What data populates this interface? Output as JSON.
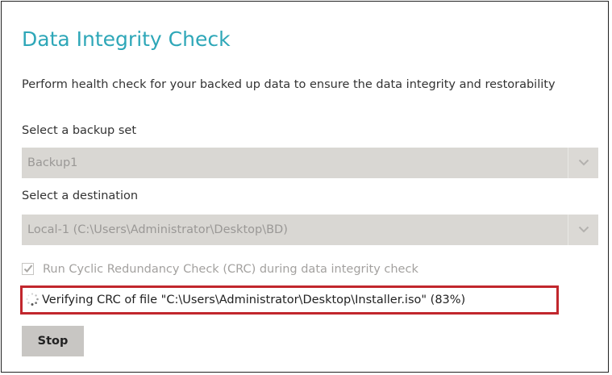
{
  "dialog": {
    "title": "Data Integrity Check",
    "description": "Perform health check for your backed up data to ensure the data integrity and restorability"
  },
  "backup_set": {
    "label": "Select a backup set",
    "selected_value": "Backup1",
    "arrow_icon": "chevron-down-icon"
  },
  "destination": {
    "label": "Select a destination",
    "selected_value": "Local-1 (C:\\Users\\Administrator\\Desktop\\BD)",
    "arrow_icon": "chevron-down-icon"
  },
  "crc_option": {
    "label": "Run Cyclic Redundancy Check (CRC) during data integrity check",
    "checked": true,
    "disabled": true
  },
  "status": {
    "text": "Verifying CRC of file \"C:\\Users\\Administrator\\Desktop\\Installer.iso\" (83%)",
    "icon": "spinner-icon",
    "highlight_color": "#c1272d"
  },
  "actions": {
    "stop_label": "Stop"
  },
  "colors": {
    "accent": "#2ea7b8",
    "field_background": "#d9d7d3",
    "button_background": "#c8c6c3"
  }
}
